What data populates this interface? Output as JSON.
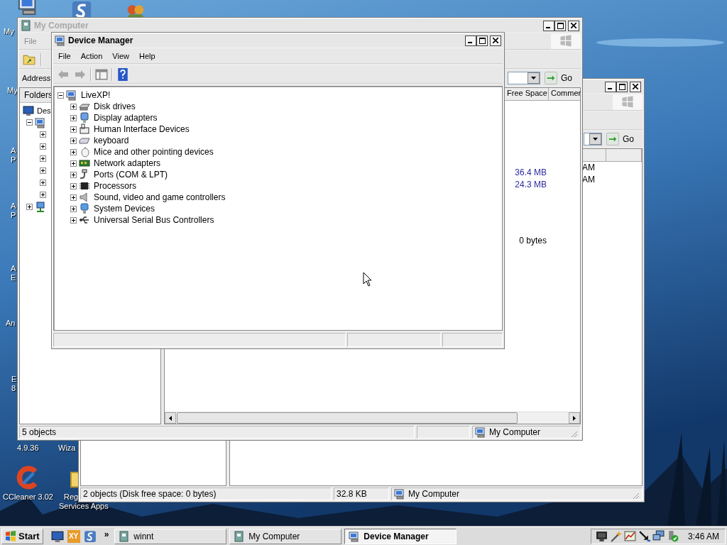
{
  "desktop_icons": [
    {
      "kind": "computer"
    },
    {
      "kind": "app"
    },
    {
      "kind": "users"
    },
    {
      "kind": "ccleaner"
    },
    {
      "kind": "folder"
    }
  ],
  "desktop_labels": [
    {
      "lines": [
        "My"
      ]
    },
    {
      "lines": [
        "My"
      ]
    },
    {
      "lines": [
        "A",
        "P"
      ]
    },
    {
      "lines": [
        "A",
        "P"
      ]
    },
    {
      "lines": [
        "A",
        "E"
      ]
    },
    {
      "lines": [
        "An"
      ]
    },
    {
      "lines": [
        "E",
        "8"
      ]
    },
    {
      "lines": [
        "4.9.36"
      ]
    },
    {
      "lines": [
        "Wiza"
      ]
    },
    {
      "lines": [
        "CCleaner 3.02"
      ]
    },
    {
      "lines": [
        "Reg"
      ]
    },
    {
      "lines": [
        "Services Apps"
      ]
    }
  ],
  "back_window": {
    "go": "Go",
    "rows": [
      "AM",
      "AM"
    ],
    "status_bar": [
      {
        "kind": "text",
        "text": "2 objects (Disk free space: 0 bytes)"
      },
      {
        "kind": "text",
        "text": "32.8 KB"
      },
      {
        "kind": "zone",
        "text": "My Computer"
      }
    ]
  },
  "my_computer": {
    "title": "My Computer",
    "active": false,
    "menu": [
      "File"
    ],
    "address_label": "Address",
    "go": "Go",
    "folders_label": "Folders",
    "tree": [
      {
        "kind": "desktop",
        "label": "Des",
        "children": [
          {
            "kind": "computer",
            "expanded": true,
            "children": [
              {
                "expanded": false
              },
              {
                "expanded": false
              },
              {
                "expanded": false
              },
              {
                "expanded": false
              },
              {
                "expanded": false
              },
              {
                "expanded": false
              }
            ]
          },
          {
            "kind": "network",
            "expanded": false
          }
        ]
      }
    ],
    "columns": [
      "Free Space",
      "Commer"
    ],
    "groups": [
      {
        "rows": [
          "36.4 MB",
          "24.3 MB"
        ]
      },
      {
        "rows": [
          "0 bytes"
        ]
      }
    ],
    "status_bar": [
      {
        "kind": "text",
        "text": "5 objects"
      },
      {
        "kind": "empty"
      },
      {
        "kind": "zone",
        "text": "My Computer"
      }
    ]
  },
  "device_manager": {
    "title": "Device Manager",
    "active": true,
    "menu": [
      "File",
      "Action",
      "View",
      "Help"
    ],
    "toolbar": [
      {
        "kind": "back",
        "disabled": true
      },
      {
        "kind": "forward",
        "disabled": true
      },
      {
        "kind": "separator"
      },
      {
        "kind": "console"
      },
      {
        "kind": "separator"
      },
      {
        "kind": "help",
        "disabled": false
      }
    ],
    "tree": [
      {
        "kind": "computer",
        "label": "LiveXP!",
        "expanded": true,
        "children": [
          {
            "kind": "disk",
            "label": "Disk drives",
            "expanded": false
          },
          {
            "kind": "display",
            "label": "Display adapters",
            "expanded": false
          },
          {
            "kind": "hid",
            "label": "Human Interface Devices",
            "expanded": false
          },
          {
            "kind": "keyboard",
            "label": "keyboard",
            "expanded": false
          },
          {
            "kind": "mouse",
            "label": "Mice and other pointing devices",
            "expanded": false
          },
          {
            "kind": "netcard",
            "label": "Network adapters",
            "expanded": false
          },
          {
            "kind": "port",
            "label": "Ports (COM & LPT)",
            "expanded": false
          },
          {
            "kind": "cpu",
            "label": "Processors",
            "expanded": false
          },
          {
            "kind": "sound",
            "label": "Sound, video and game controllers",
            "expanded": false
          },
          {
            "kind": "system",
            "label": "System Devices",
            "expanded": false
          },
          {
            "kind": "usb",
            "label": "Universal Serial Bus Controllers",
            "expanded": false
          }
        ]
      }
    ]
  },
  "taskbar": {
    "start": "Start",
    "quick_launch": [
      {
        "kind": "desktop"
      },
      {
        "kind": "xy",
        "label": "XY"
      },
      {
        "kind": "app"
      }
    ],
    "more": "»",
    "tasks": [
      {
        "kind": "explorer",
        "label": "winnt",
        "selected": false
      },
      {
        "kind": "explorer",
        "label": "My Computer",
        "selected": false
      },
      {
        "kind": "computer",
        "label": "Device Manager",
        "selected": true
      }
    ],
    "tray": [
      {
        "kind": "monitor"
      },
      {
        "kind": "wand"
      },
      {
        "kind": "chart"
      },
      {
        "kind": "arrow"
      },
      {
        "kind": "network2"
      },
      {
        "kind": "security"
      }
    ],
    "clock": "3:46 AM"
  }
}
